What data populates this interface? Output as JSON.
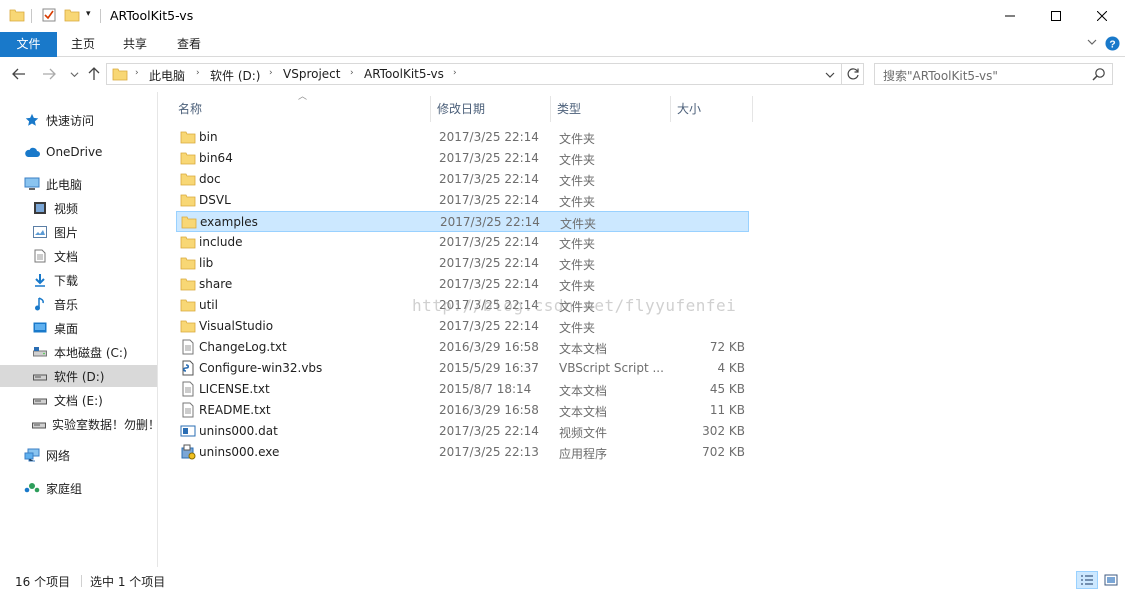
{
  "window": {
    "title": "ARToolKit5-vs",
    "minimize": "—",
    "maximize": "☐",
    "close": "✕"
  },
  "ribbon": {
    "tabs": [
      "文件",
      "主页",
      "共享",
      "查看"
    ]
  },
  "address": {
    "segments": [
      "此电脑",
      "软件 (D:)",
      "VSproject",
      "ARToolKit5-vs"
    ]
  },
  "search": {
    "placeholder": "搜索\"ARToolKit5-vs\""
  },
  "nav": {
    "items": [
      {
        "label": "快速访问",
        "icon": "star-icon"
      },
      {
        "label": "OneDrive",
        "icon": "cloud-icon"
      },
      {
        "label": "此电脑",
        "icon": "computer-icon"
      },
      {
        "label": "视频",
        "icon": "video-icon"
      },
      {
        "label": "图片",
        "icon": "picture-icon"
      },
      {
        "label": "文档",
        "icon": "document-icon"
      },
      {
        "label": "下载",
        "icon": "download-icon"
      },
      {
        "label": "音乐",
        "icon": "music-icon"
      },
      {
        "label": "桌面",
        "icon": "desktop-icon"
      },
      {
        "label": "本地磁盘 (C:)",
        "icon": "drive-icon"
      },
      {
        "label": "软件 (D:)",
        "icon": "drive-icon"
      },
      {
        "label": "文档 (E:)",
        "icon": "drive-icon"
      },
      {
        "label": "实验室数据！勿删！",
        "icon": "drive-icon"
      },
      {
        "label": "网络",
        "icon": "network-icon"
      },
      {
        "label": "家庭组",
        "icon": "homegroup-icon"
      }
    ]
  },
  "columns": {
    "name": "名称",
    "date": "修改日期",
    "type": "类型",
    "size": "大小"
  },
  "files": [
    {
      "name": "bin",
      "date": "2017/3/25 22:14",
      "type": "文件夹",
      "size": "",
      "icon": "folder-icon"
    },
    {
      "name": "bin64",
      "date": "2017/3/25 22:14",
      "type": "文件夹",
      "size": "",
      "icon": "folder-icon"
    },
    {
      "name": "doc",
      "date": "2017/3/25 22:14",
      "type": "文件夹",
      "size": "",
      "icon": "folder-icon"
    },
    {
      "name": "DSVL",
      "date": "2017/3/25 22:14",
      "type": "文件夹",
      "size": "",
      "icon": "folder-icon"
    },
    {
      "name": "examples",
      "date": "2017/3/25 22:14",
      "type": "文件夹",
      "size": "",
      "icon": "folder-icon"
    },
    {
      "name": "include",
      "date": "2017/3/25 22:14",
      "type": "文件夹",
      "size": "",
      "icon": "folder-icon"
    },
    {
      "name": "lib",
      "date": "2017/3/25 22:14",
      "type": "文件夹",
      "size": "",
      "icon": "folder-icon"
    },
    {
      "name": "share",
      "date": "2017/3/25 22:14",
      "type": "文件夹",
      "size": "",
      "icon": "folder-icon"
    },
    {
      "name": "util",
      "date": "2017/3/25 22:14",
      "type": "文件夹",
      "size": "",
      "icon": "folder-icon"
    },
    {
      "name": "VisualStudio",
      "date": "2017/3/25 22:14",
      "type": "文件夹",
      "size": "",
      "icon": "folder-icon"
    },
    {
      "name": "ChangeLog.txt",
      "date": "2016/3/29 16:58",
      "type": "文本文档",
      "size": "72 KB",
      "icon": "text-file-icon"
    },
    {
      "name": "Configure-win32.vbs",
      "date": "2015/5/29 16:37",
      "type": "VBScript Script ...",
      "size": "4 KB",
      "icon": "script-file-icon"
    },
    {
      "name": "LICENSE.txt",
      "date": "2015/8/7 18:14",
      "type": "文本文档",
      "size": "45 KB",
      "icon": "text-file-icon"
    },
    {
      "name": "README.txt",
      "date": "2016/3/29 16:58",
      "type": "文本文档",
      "size": "11 KB",
      "icon": "text-file-icon"
    },
    {
      "name": "unins000.dat",
      "date": "2017/3/25 22:14",
      "type": "视频文件",
      "size": "302 KB",
      "icon": "video-file-icon"
    },
    {
      "name": "unins000.exe",
      "date": "2017/3/25 22:13",
      "type": "应用程序",
      "size": "702 KB",
      "icon": "installer-icon"
    }
  ],
  "selected_file": "examples",
  "selected_nav": "软件 (D:)",
  "watermark": "http://blog.csdn.net/flyyufenfei",
  "status": {
    "item_count": "16 个项目",
    "selected_count": "选中 1 个项目"
  },
  "colors": {
    "accent": "#1979ca",
    "folder": "#f8d775",
    "selection_bg": "#cce8ff",
    "selection_border": "#99d1ff"
  }
}
